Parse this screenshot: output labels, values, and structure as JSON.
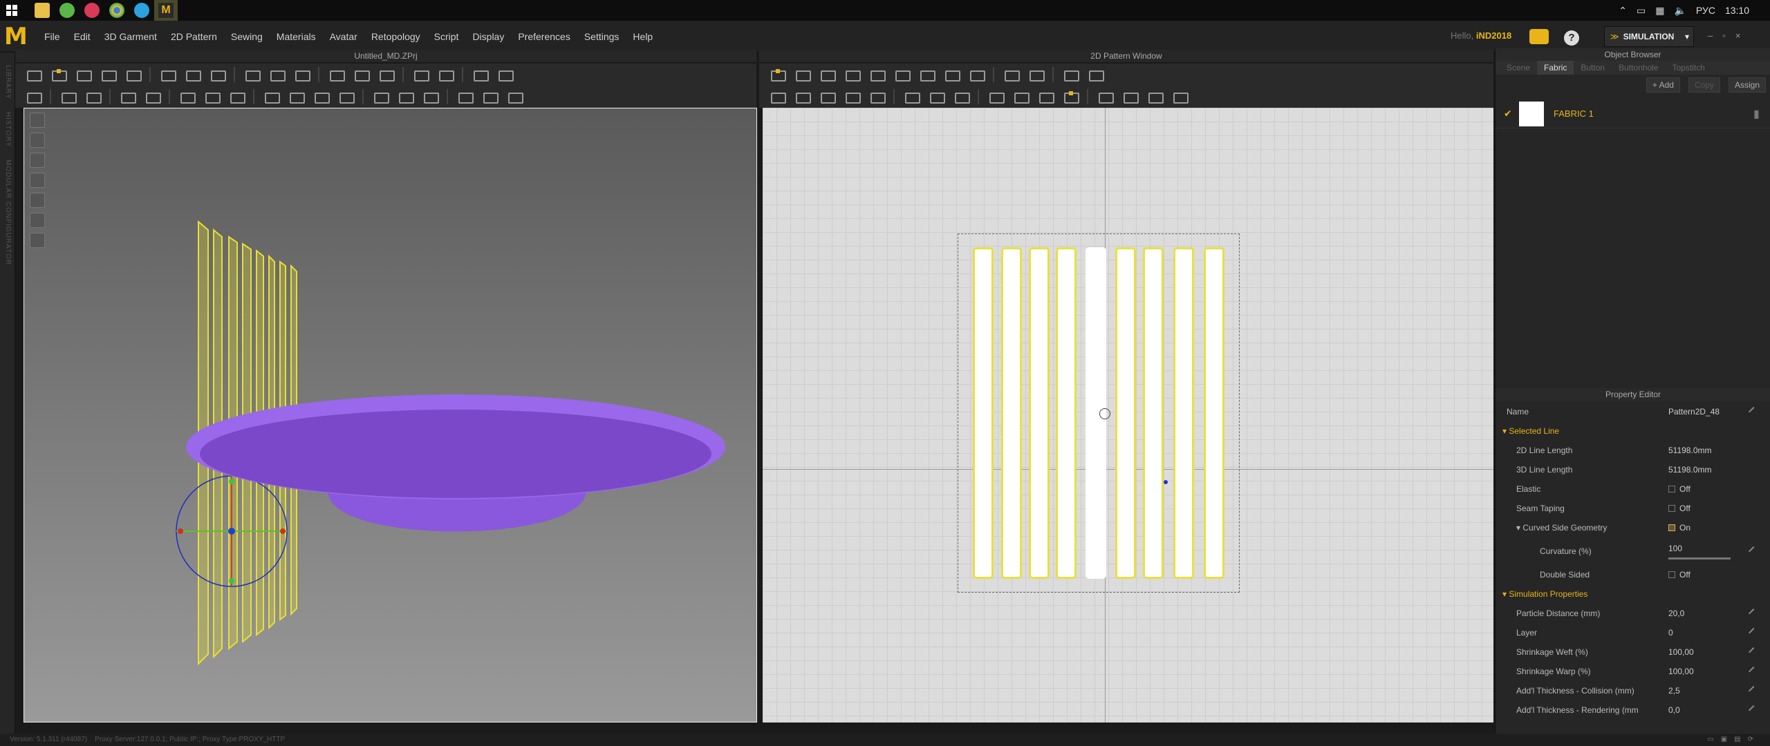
{
  "taskbar": {
    "lang": "РУС",
    "time": "13:10"
  },
  "menubar": {
    "items": [
      "File",
      "Edit",
      "3D Garment",
      "2D Pattern",
      "Sewing",
      "Materials",
      "Avatar",
      "Retopology",
      "Script",
      "Display",
      "Preferences",
      "Settings",
      "Help"
    ],
    "hello": "Hello,",
    "user": "iND2018",
    "mode": "SIMULATION"
  },
  "sidebar": {
    "labels": [
      "LIBRARY",
      "HISTORY",
      "MODULAR CONFIGURATOR"
    ]
  },
  "view3d": {
    "title": "Untitled_MD.ZPrj"
  },
  "view2d": {
    "title": "2D Pattern Window"
  },
  "object_browser": {
    "title": "Object Browser",
    "tabs": [
      "Scene",
      "Fabric",
      "Button",
      "Buttonhole",
      "Topstitch"
    ],
    "actions": {
      "add": "+ Add",
      "copy": "Copy",
      "assign": "Assign"
    },
    "fabric_name": "FABRIC 1"
  },
  "property_editor": {
    "title": "Property Editor",
    "name_label": "Name",
    "name_value": "Pattern2D_48",
    "selected_line": "Selected Line",
    "line_2d_label": "2D Line Length",
    "line_2d_value": "51198.0mm",
    "line_3d_label": "3D Line Length",
    "line_3d_value": "51198.0mm",
    "elastic_label": "Elastic",
    "elastic_value": "Off",
    "seam_label": "Seam Taping",
    "seam_value": "Off",
    "curved_label": "Curved Side Geometry",
    "curved_value": "On",
    "curvature_label": "Curvature (%)",
    "curvature_value": "100",
    "double_label": "Double Sided",
    "double_value": "Off",
    "sim_props": "Simulation Properties",
    "particle_label": "Particle Distance (mm)",
    "particle_value": "20,0",
    "layer_label": "Layer",
    "layer_value": "0",
    "weft_label": "Shrinkage Weft (%)",
    "weft_value": "100,00",
    "warp_label": "Shrinkage Warp (%)",
    "warp_value": "100,00",
    "collision_label": "Add'l Thickness - Collision (mm)",
    "collision_value": "2,5",
    "rendering_label": "Add'l Thickness - Rendering (mm",
    "rendering_value": "0,0"
  },
  "statusbar": {
    "version": "Version: 5.1.311 (r44087)",
    "proxy": "Proxy Server:127.0.0.1; Public IP:; Proxy Type:PROXY_HTTP"
  },
  "colors": {
    "accent": "#e8b418",
    "pattern_outline": "#e8e040",
    "avatar_purple": "#9060e0"
  }
}
